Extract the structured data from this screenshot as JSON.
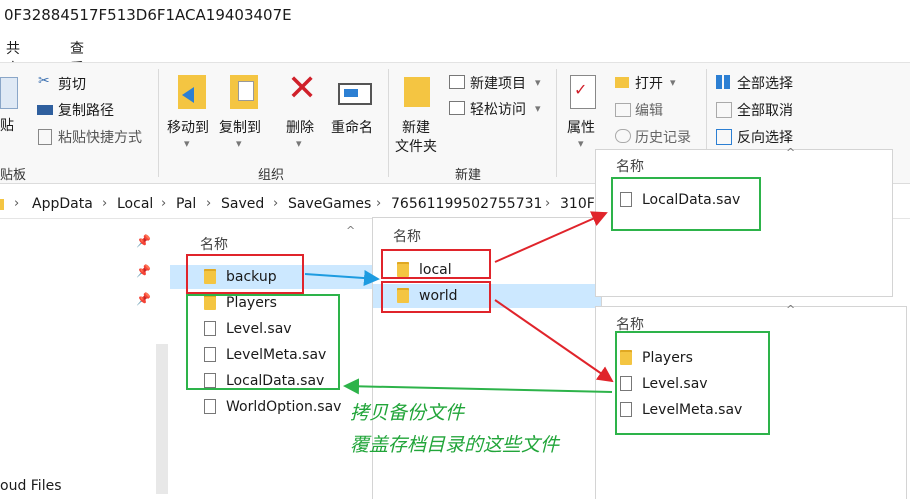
{
  "window": {
    "title": "0F32884517F513D6F1ACA19403407E"
  },
  "tabs": [
    "共享",
    "查看"
  ],
  "ribbon": {
    "clipboard": {
      "cut": "剪切",
      "copy_path": "复制路径",
      "paste_shortcut": "粘贴快捷方式",
      "paste_partial": "贴",
      "group_partial": "贴板"
    },
    "organize": {
      "move_to": "移动到",
      "copy_to": "复制到",
      "delete": "删除",
      "rename": "重命名",
      "group": "组织"
    },
    "new": {
      "new_item": "新建项目",
      "easy_access": "轻松访问",
      "new_folder_l1": "新建",
      "new_folder_l2": "文件夹",
      "group": "新建"
    },
    "open": {
      "open": "打开",
      "edit": "编辑",
      "history": "历史记录",
      "properties": "属性"
    },
    "select": {
      "select_all": "全部选择",
      "select_none": "全部取消",
      "invert": "反向选择"
    }
  },
  "breadcrumb": [
    "AppData",
    "Local",
    "Pal",
    "Saved",
    "SaveGames",
    "76561199502755731",
    "310F"
  ],
  "nav": {
    "bottom_item": "oud Files"
  },
  "main_pane": {
    "column": "名称",
    "items": [
      {
        "name": "backup",
        "type": "folder"
      },
      {
        "name": "Players",
        "type": "folder"
      },
      {
        "name": "Level.sav",
        "type": "file"
      },
      {
        "name": "LevelMeta.sav",
        "type": "file"
      },
      {
        "name": "LocalData.sav",
        "type": "file"
      },
      {
        "name": "WorldOption.sav",
        "type": "file"
      }
    ]
  },
  "backup_pane": {
    "column": "名称",
    "items": [
      {
        "name": "local",
        "type": "folder"
      },
      {
        "name": "world",
        "type": "folder"
      }
    ]
  },
  "local_pane": {
    "column": "名称",
    "items": [
      {
        "name": "LocalData.sav",
        "type": "file"
      }
    ]
  },
  "world_pane": {
    "column": "名称",
    "items": [
      {
        "name": "Players",
        "type": "folder"
      },
      {
        "name": "Level.sav",
        "type": "file"
      },
      {
        "name": "LevelMeta.sav",
        "type": "file"
      }
    ]
  },
  "annotation": {
    "line1": "拷贝备份文件",
    "line2": "覆盖存档目录的这些文件"
  },
  "colors": {
    "red": "#e0242b",
    "green": "#2db34a",
    "arrow_blue": "#1e9be0",
    "selection": "#cce8ff"
  }
}
